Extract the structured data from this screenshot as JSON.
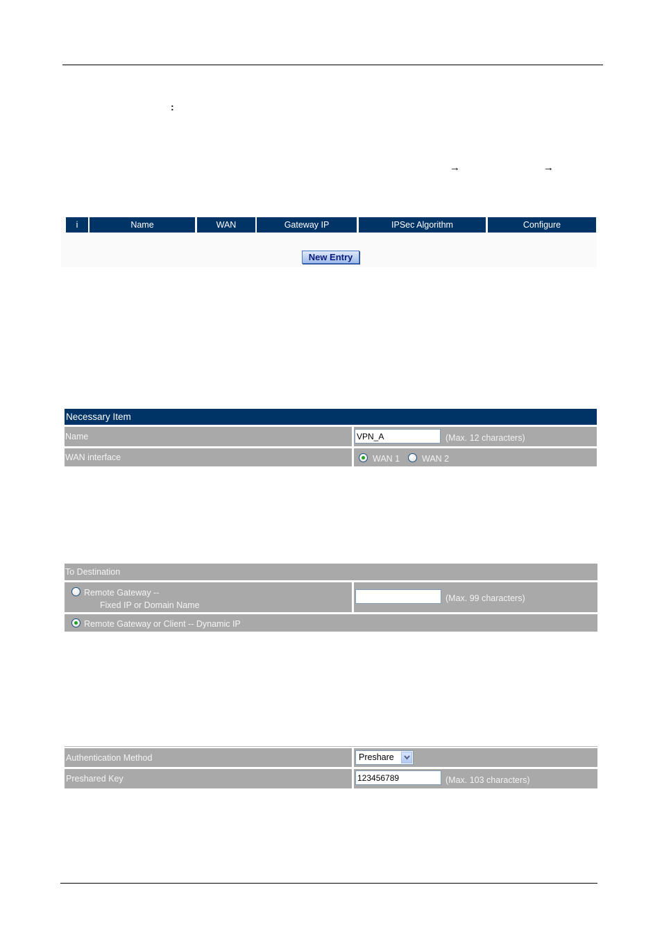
{
  "page": {
    "header_separator": true,
    "colon_text": ":",
    "arrows": [
      "→",
      "→"
    ]
  },
  "vpn_list": {
    "columns": [
      "i",
      "Name",
      "WAN",
      "Gateway IP",
      "IPSec Algorithm",
      "Configure"
    ],
    "new_entry_label": "New Entry"
  },
  "necessary_item": {
    "title": "Necessary Item",
    "name_label": "Name",
    "name_value": "VPN_A",
    "name_hint": "(Max. 12 characters)",
    "wan_label": "WAN interface",
    "wan_options": [
      {
        "label": "WAN 1",
        "checked": true
      },
      {
        "label": "WAN 2",
        "checked": false
      }
    ]
  },
  "destination": {
    "title": "To Destination",
    "fixed_option_line1": "Remote Gateway --",
    "fixed_option_line2": "Fixed IP or Domain Name",
    "fixed_value": "",
    "fixed_hint": "(Max. 99 characters)",
    "dynamic_option": "Remote Gateway or Client -- Dynamic IP",
    "selected": "dynamic"
  },
  "authentication": {
    "method_label": "Authentication Method",
    "method_value": "Preshare",
    "key_label": "Preshared Key",
    "key_value": "123456789",
    "key_hint": "(Max. 103 characters)"
  }
}
